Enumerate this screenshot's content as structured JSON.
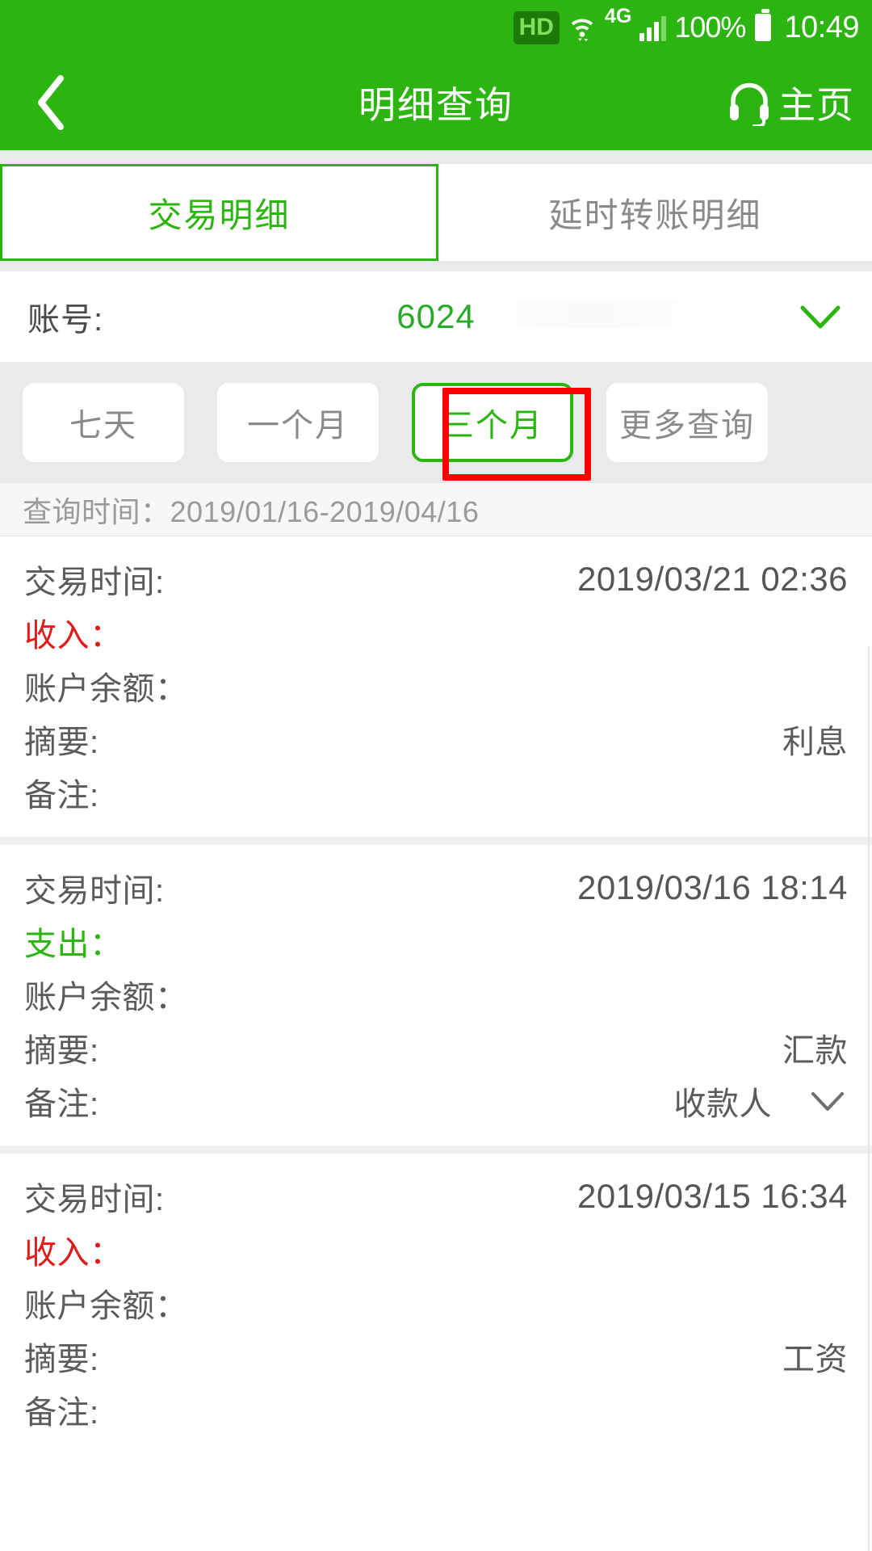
{
  "status_bar": {
    "hd_badge": "HD",
    "wifi_icon": "wifi-icon",
    "network_type": "4G",
    "signal_icon": "signal-bars-icon",
    "battery_percent": "100%",
    "battery_icon": "battery-full-icon",
    "time": "10:49"
  },
  "header": {
    "back_icon": "back-chevron-icon",
    "title": "明细查询",
    "home_icon": "headset-icon",
    "home_label": "主页"
  },
  "tabs": [
    {
      "label": "交易明细",
      "active": true
    },
    {
      "label": "延时转账明细",
      "active": false
    }
  ],
  "account": {
    "label": "账号:",
    "value": "6024",
    "dropdown_icon": "chevron-down-icon"
  },
  "filters": {
    "buttons": [
      {
        "label": "七天",
        "selected": false
      },
      {
        "label": "一个月",
        "selected": false
      },
      {
        "label": "三个月",
        "selected": true
      },
      {
        "label": "更多查询",
        "selected": false
      }
    ],
    "annotation": "red-highlight-box"
  },
  "query_period": "查询时间：2019/01/16-2019/04/16",
  "field_labels": {
    "time": "交易时间:",
    "income": "收入：",
    "expense": "支出：",
    "balance": "账户余额：",
    "summary": "摘要:",
    "note": "备注:"
  },
  "transactions": [
    {
      "time": "2019/03/21 02:36",
      "direction": "income",
      "direction_label": "收入：",
      "amount": "",
      "balance": "",
      "summary": "利息",
      "note": "",
      "note_expandable": false
    },
    {
      "time": "2019/03/16 18:14",
      "direction": "expense",
      "direction_label": "支出：",
      "amount": "",
      "balance": "",
      "summary": "汇款",
      "note": "收款人",
      "note_expandable": true
    },
    {
      "time": "2019/03/15 16:34",
      "direction": "income",
      "direction_label": "收入：",
      "amount": "",
      "balance": "",
      "summary": "工资",
      "note": "",
      "note_expandable": false
    }
  ],
  "colors": {
    "brand_green": "#2cb410",
    "income_red": "#e01b1b",
    "expense_green": "#2cb410",
    "annotation_red": "#ff0000",
    "panel_gray": "#e8ebea"
  }
}
